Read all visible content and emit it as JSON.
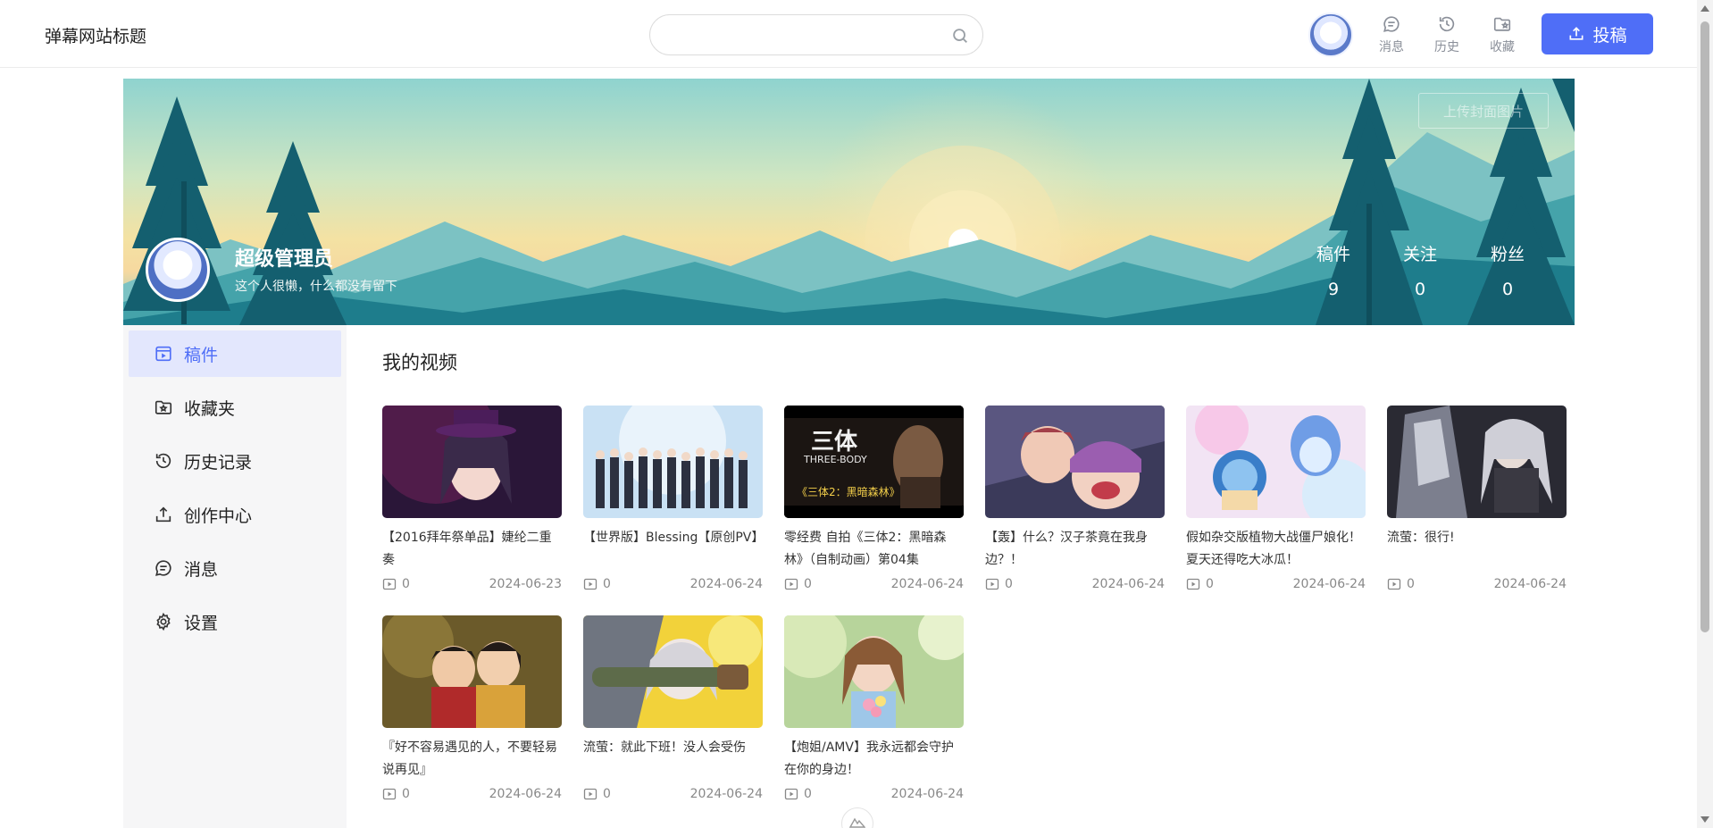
{
  "header": {
    "site_title": "弹幕网站标题",
    "search": {
      "value": "",
      "placeholder": ""
    },
    "nav": [
      {
        "label": "消息",
        "icon": "message-icon"
      },
      {
        "label": "历史",
        "icon": "history-icon"
      },
      {
        "label": "收藏",
        "icon": "favorite-folder-icon"
      }
    ],
    "post_label": "投稿"
  },
  "banner": {
    "upload_label": "上传封面图片",
    "name": "超级管理员",
    "signature": "这个人很懒，什么都没有留下",
    "stats": [
      {
        "label": "稿件",
        "value": "9"
      },
      {
        "label": "关注",
        "value": "0"
      },
      {
        "label": "粉丝",
        "value": "0"
      }
    ]
  },
  "sidebar": {
    "items": [
      {
        "label": "稿件",
        "icon": "video-icon"
      },
      {
        "label": "收藏夹",
        "icon": "star-folder-icon"
      },
      {
        "label": "历史记录",
        "icon": "history-icon"
      },
      {
        "label": "创作中心",
        "icon": "upload-icon"
      },
      {
        "label": "消息",
        "icon": "message-icon"
      },
      {
        "label": "设置",
        "icon": "gear-icon"
      }
    ]
  },
  "main": {
    "title": "我的视频",
    "videos": [
      {
        "title": "【2016拜年祭单品】婕纶二重奏",
        "views": "0",
        "date": "2024-06-23"
      },
      {
        "title": "【世界版】Blessing【原创PV】",
        "views": "0",
        "date": "2024-06-24"
      },
      {
        "title": "零经费 自拍《三体2：黑暗森林》（自制动画）第04集",
        "views": "0",
        "date": "2024-06-24"
      },
      {
        "title": "【轰】什么？汉子茶竟在我身边？！",
        "views": "0",
        "date": "2024-06-24"
      },
      {
        "title": "假如杂交版植物大战僵尸娘化！夏天还得吃大冰瓜！",
        "views": "0",
        "date": "2024-06-24"
      },
      {
        "title": "流萤：很行!",
        "views": "0",
        "date": "2024-06-24"
      },
      {
        "title": "『好不容易遇见的人，不要轻易说再见』",
        "views": "0",
        "date": "2024-06-24"
      },
      {
        "title": "流萤：就此下班！没人会受伤",
        "views": "0",
        "date": "2024-06-24"
      },
      {
        "title": "【炮姐/AMV】我永远都会守护在你的身边！",
        "views": "0",
        "date": "2024-06-24"
      }
    ],
    "thumb_text": {
      "three_body_title": "三体",
      "three_body_en": "THREE-BODY",
      "three_body_sub": "《三体2：黑暗森林》"
    }
  },
  "colors": {
    "accent": "#4f6ef7",
    "active_bg": "#e3e7fd",
    "sidebar_bg": "#f6f6f7"
  }
}
